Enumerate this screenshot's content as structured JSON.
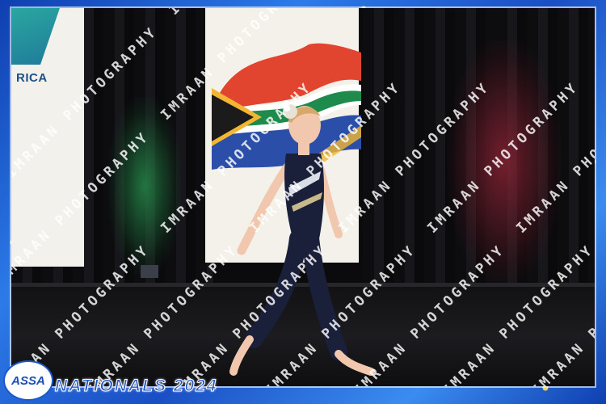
{
  "banner": {
    "left_text": "RICA"
  },
  "logo": {
    "text": "ASSA"
  },
  "event": {
    "title": "NATIONALS 2024"
  },
  "watermark": {
    "text": "IMRAAN PHOTOGRAPHY"
  },
  "colors": {
    "frame_blue": "#1d58c9",
    "title_blue": "#1f57c4",
    "leotard": "#1a1f3a",
    "flag_red": "#e2452f",
    "flag_green": "#1e8a4c",
    "flag_blue": "#2b4fa8",
    "flag_gold": "#f2b632"
  }
}
